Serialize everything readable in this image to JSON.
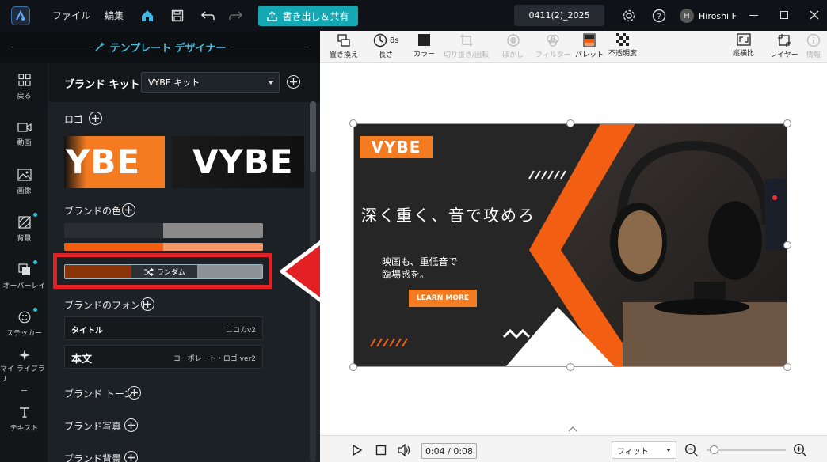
{
  "titlebar": {
    "menu_file": "ファイル",
    "menu_edit": "編集",
    "export_label": "書き出し＆共有",
    "project_title": "0411(2)_2025",
    "user_initial": "H",
    "user_name": "Hiroshi F"
  },
  "designer": {
    "title": "テンプレート デザイナー"
  },
  "leftnav": {
    "items": [
      {
        "label": "戻る",
        "icon": "grid-icon"
      },
      {
        "label": "動画",
        "icon": "video-icon"
      },
      {
        "label": "画像",
        "icon": "image-icon"
      },
      {
        "label": "背景",
        "icon": "pattern-icon"
      },
      {
        "label": "オーバーレイ",
        "icon": "overlay-icon"
      },
      {
        "label": "ステッカー",
        "icon": "sticker-icon"
      },
      {
        "label": "マイ ライブラリ",
        "label2": "ー",
        "icon": "sparkle-icon"
      },
      {
        "label": "テキスト",
        "icon": "text-icon"
      }
    ]
  },
  "brandkit": {
    "title": "ブランド キット",
    "kit_name": "VYBE キット",
    "logo_label": "ロゴ",
    "logo_text_1": "YBE",
    "logo_text_2": "VYBE",
    "colors_label": "ブランドの色",
    "random_label": "ランダム",
    "fonts_label": "ブランドのフォント",
    "font_title_name": "タイトル",
    "font_title_value": "ニコカv2",
    "font_body_name": "本文",
    "font_body_value": "コーポレート・ロゴ ver2",
    "tone_label": "ブランド トーン",
    "photo_label": "ブランド写真",
    "bg_label": "ブランド背景"
  },
  "toolbar": {
    "replace": "置き換え",
    "duration_value": "8s",
    "duration": "長さ",
    "color": "カラー",
    "crop": "切り抜き/回転",
    "blur": "ぼかし",
    "filter": "フィルター",
    "palette": "パレット",
    "opacity": "不透明度",
    "aspect": "縦横比",
    "layer": "レイヤー",
    "info": "情報"
  },
  "banner": {
    "logo": "VYBE",
    "headline": "深く重く、音で攻めろ",
    "sub1": "映画も、重低音で",
    "sub2": "臨場感を。",
    "cta": "LEARN MORE"
  },
  "player": {
    "time": "0:04 / 0:08",
    "fit": "フィット",
    "zoom_level": 0.05
  },
  "colors": {
    "accent": "#14a7b4",
    "orange": "#f47b20",
    "highlight": "#e32125"
  }
}
